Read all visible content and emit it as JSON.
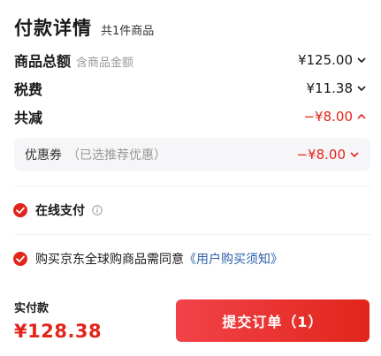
{
  "header": {
    "title": "付款详情",
    "count": "共1件商品"
  },
  "rows": [
    {
      "label": "商品总额",
      "sub": "含商品金额",
      "value": "¥125.00"
    },
    {
      "label": "税费",
      "value": "¥11.38"
    },
    {
      "label": "共减",
      "value": "−¥8.00"
    }
  ],
  "coupon": {
    "label": "优惠券",
    "hint": "（已选推荐优惠）",
    "value": "−¥8.00"
  },
  "payment": {
    "label": "在线支付"
  },
  "agreement": {
    "text": "购买京东全球购商品需同意",
    "link": "《用户购买须知》"
  },
  "footer": {
    "paid_label": "实付款",
    "paid_amount": "¥128.38",
    "submit_label": "提交订单（1）"
  },
  "colors": {
    "accent": "#e1251b",
    "link": "#2b5ea8"
  }
}
